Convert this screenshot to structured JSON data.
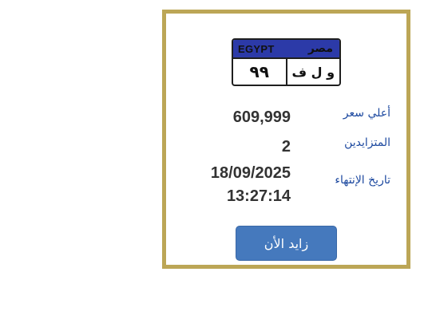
{
  "plate": {
    "country_en": "EGYPT",
    "country_ar": "مصر",
    "numbers": "٩٩",
    "letters": "و ل ف",
    "top_color": "#2c3aa8"
  },
  "details": {
    "highest_price_label": "أعلي سعر",
    "highest_price_value": "609,999",
    "bidders_label": "المتزايدين",
    "bidders_value": "2",
    "end_date_label": "تاريخ الإنتهاء",
    "end_date_value": "18/09/2025",
    "end_time_value": "13:27:14"
  },
  "actions": {
    "bid_now_label": "زايد الأن"
  },
  "colors": {
    "border": "#bca656",
    "label": "#1e4aa0",
    "value": "#333333",
    "button": "#4579bd"
  }
}
